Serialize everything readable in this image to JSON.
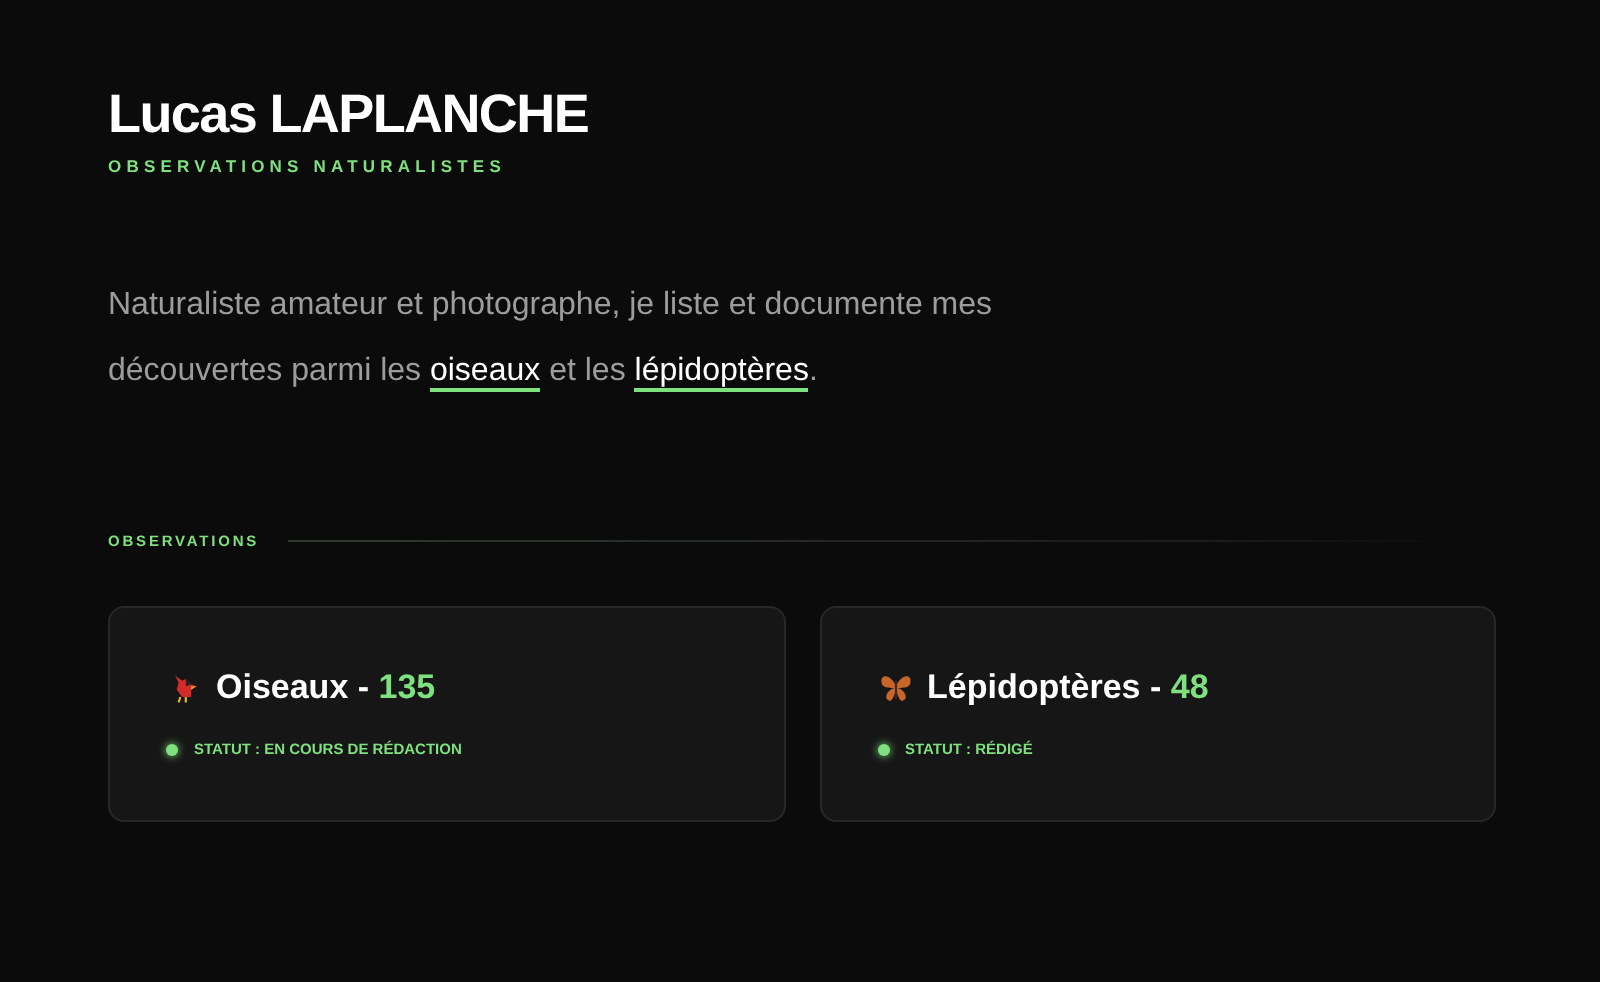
{
  "header": {
    "name": "Lucas LAPLANCHE",
    "subtitle": "OBSERVATIONS NATURALISTES"
  },
  "intro": [
    {
      "kind": "text",
      "text": "Naturaliste amateur et photographe, je liste et documente mes découvertes parmi les "
    },
    {
      "kind": "link",
      "text": "oiseaux"
    },
    {
      "kind": "text",
      "text": " et les "
    },
    {
      "kind": "link",
      "text": "lépidoptères"
    },
    {
      "kind": "text",
      "text": "."
    }
  ],
  "section": {
    "label": "OBSERVATIONS"
  },
  "cards": [
    {
      "kind": "bird",
      "title": "Oiseaux - ",
      "count": "135",
      "status": "STATUT : EN COURS DE RÉDACTION"
    },
    {
      "kind": "butterfly",
      "title": "Lépidoptères - ",
      "count": "48",
      "status": "STATUT : RÉDIGÉ"
    }
  ]
}
